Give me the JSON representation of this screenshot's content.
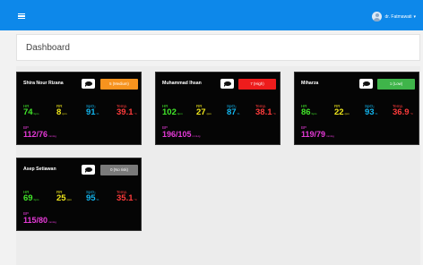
{
  "user": {
    "name": "dr. Fatmawati"
  },
  "page": {
    "title": "Dashboard"
  },
  "labels": {
    "hr": "HR",
    "rr": "RR",
    "spo2": "SpO₂",
    "temp": "Temp.",
    "bp": "BP"
  },
  "units": {
    "hr": "bpm",
    "rr": "rpm",
    "spo2": "%",
    "temp": "°C",
    "bp": "mmHg"
  },
  "colors": {
    "topbar": "#0d88ea",
    "medium": "#f7931e",
    "high": "#ee1c1c",
    "low": "#3fb54a",
    "none": "#7a7a7a"
  },
  "patients": [
    {
      "name": "Shira Nour Rizana",
      "badge": "5 (Medium)",
      "level": "medium",
      "hr": "74",
      "rr": "8",
      "spo2": "91",
      "temp": "39.1",
      "bp": "112/76"
    },
    {
      "name": "Muhammad Ihsan",
      "badge": "7 (High)",
      "level": "high",
      "hr": "102",
      "rr": "27",
      "spo2": "87",
      "temp": "38.1",
      "bp": "196/105"
    },
    {
      "name": "Miharza",
      "badge": "1 (Low)",
      "level": "low",
      "hr": "86",
      "rr": "22",
      "spo2": "93",
      "temp": "36.9",
      "bp": "119/79"
    },
    {
      "name": "Asep Setiawan",
      "badge": "0 (No risk)",
      "level": "none",
      "hr": "69",
      "rr": "25",
      "spo2": "95",
      "temp": "35.1",
      "bp": "115/80"
    }
  ]
}
